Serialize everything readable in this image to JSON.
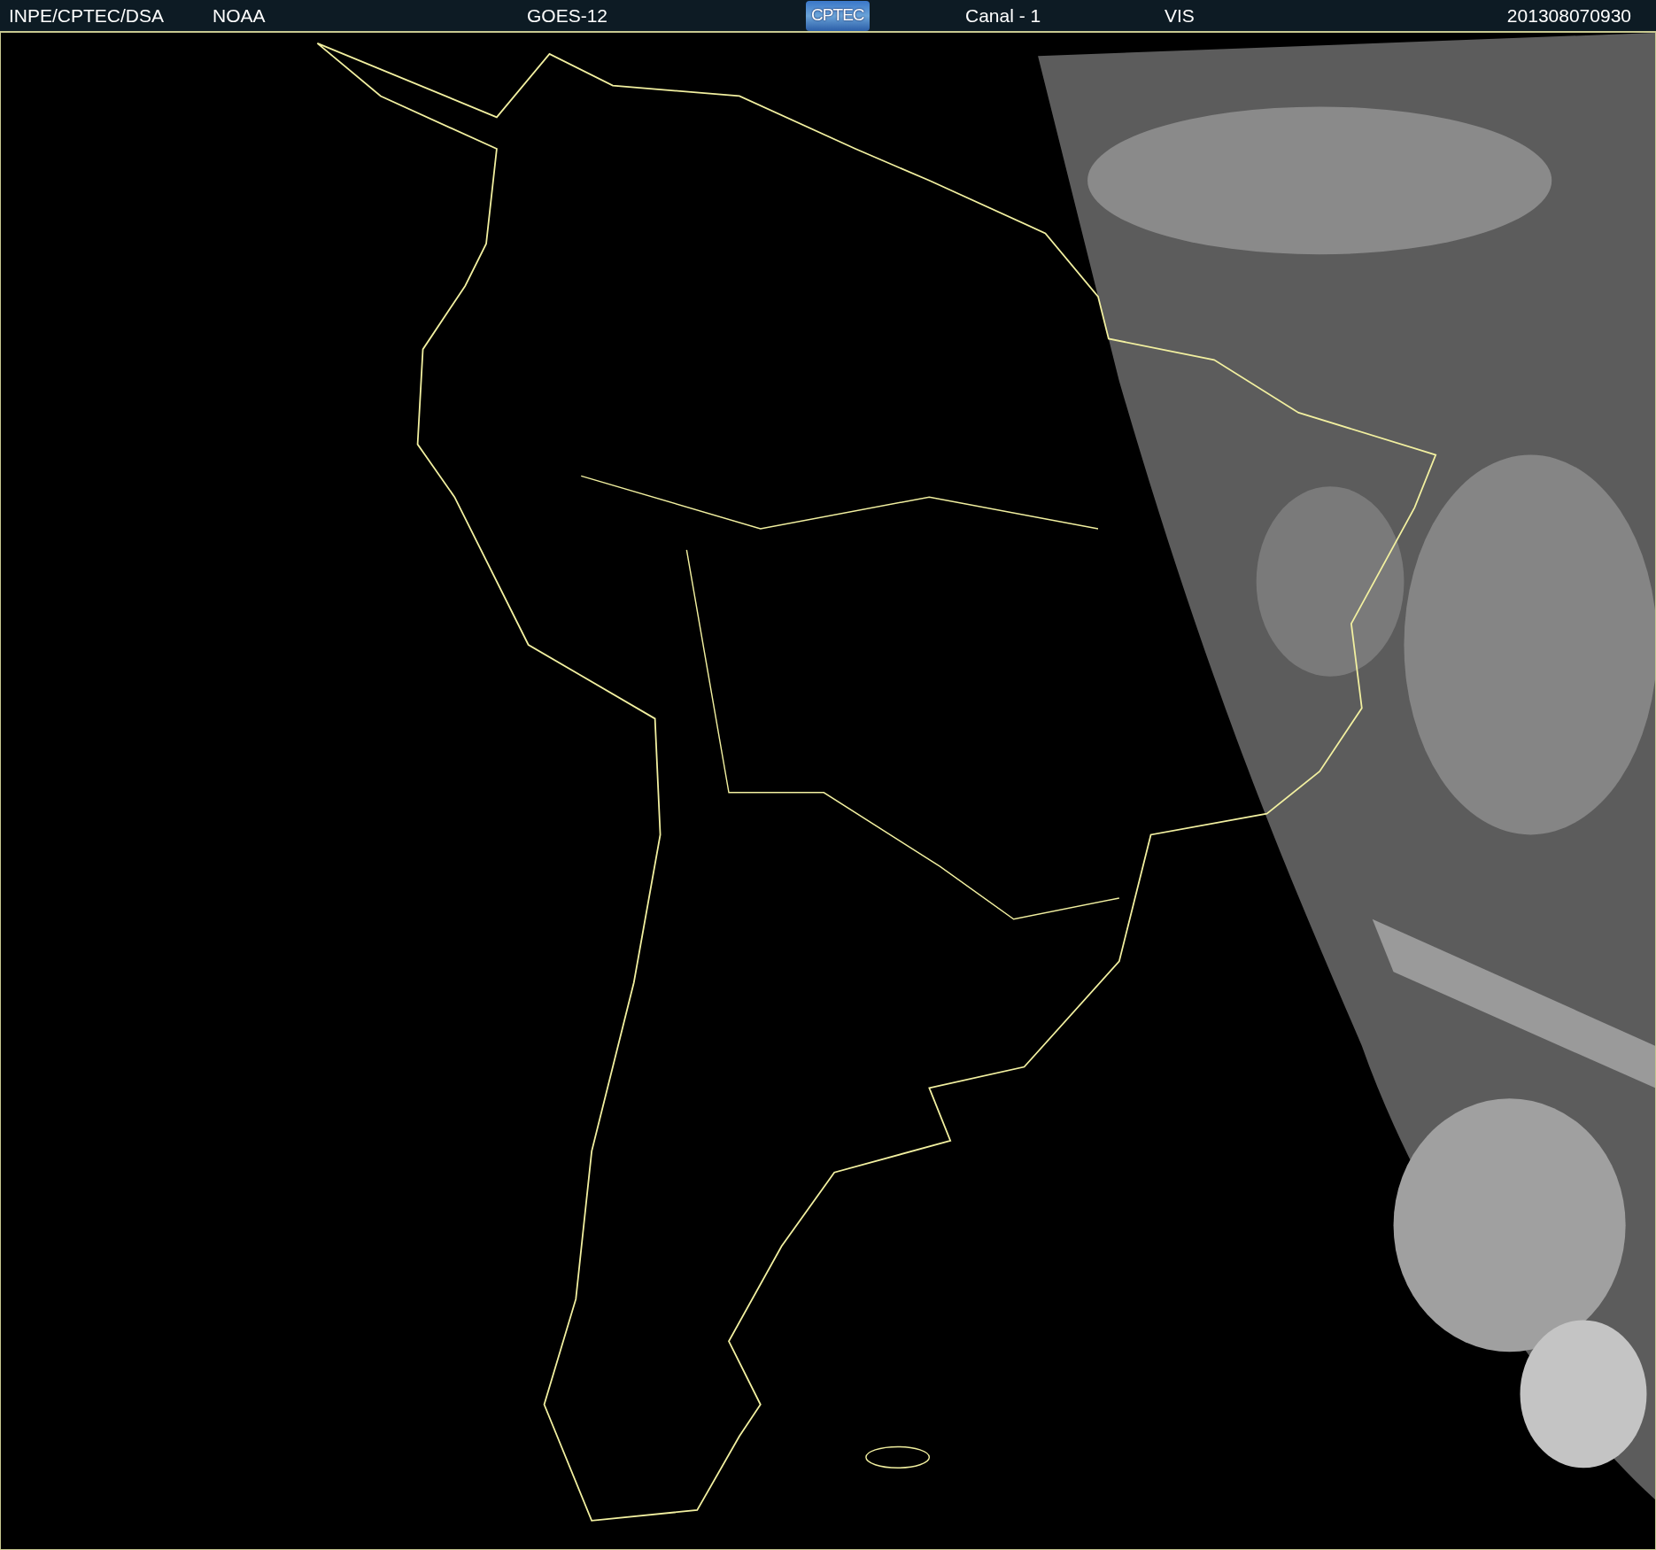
{
  "header": {
    "labels": [
      {
        "text": "INPE/CPTEC/DSA",
        "kind": "source"
      },
      {
        "text": "NOAA",
        "kind": "agency"
      },
      {
        "text": "GOES-12",
        "kind": "satellite"
      },
      {
        "text": "CPTEC",
        "kind": "logo"
      },
      {
        "text": "Canal - 1",
        "kind": "channel"
      },
      {
        "text": "VIS",
        "kind": "band"
      },
      {
        "text": "201308070930",
        "kind": "timestamp"
      }
    ]
  }
}
